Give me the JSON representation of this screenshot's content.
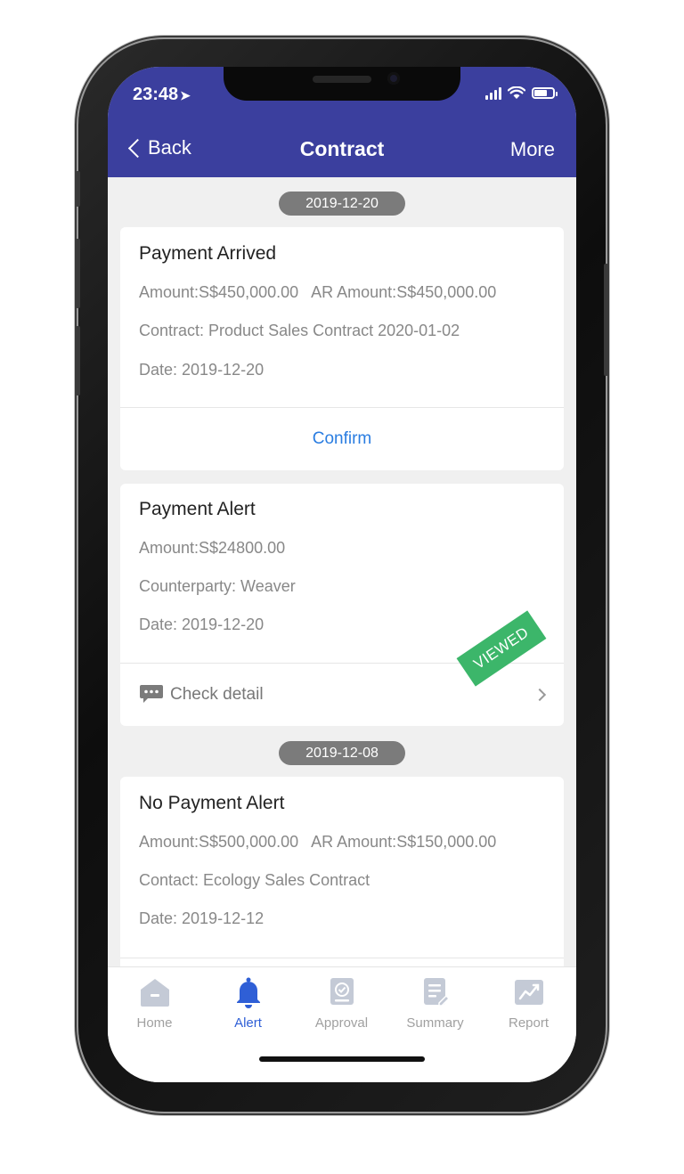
{
  "status_bar": {
    "time": "23:48"
  },
  "nav": {
    "back_label": "Back",
    "title": "Contract",
    "more_label": "More"
  },
  "groups": [
    {
      "date": "2019-12-20",
      "cards": [
        {
          "title": "Payment Arrived",
          "amount": "Amount:S$450,000.00",
          "ar_amount": "AR Amount:S$450,000.00",
          "line2": "Contract: Product Sales Contract 2020-01-02",
          "line3": "Date: 2019-12-20",
          "action": "Confirm"
        },
        {
          "title": "Payment Alert",
          "amount": "Amount:S$24800.00",
          "line2": "Counterparty: Weaver",
          "line3": "Date: 2019-12-20",
          "detail_label": "Check detail",
          "stamp": "VIEWED"
        }
      ]
    },
    {
      "date": "2019-12-08",
      "cards": [
        {
          "title": "No Payment Alert",
          "amount": "Amount:S$500,000.00",
          "ar_amount": "AR Amount:S$150,000.00",
          "line2": "Contact: Ecology Sales Contract",
          "line3": "Date: 2019-12-12"
        }
      ]
    }
  ],
  "tabs": [
    {
      "label": "Home",
      "icon": "home-icon",
      "active": false
    },
    {
      "label": "Alert",
      "icon": "bell-icon",
      "active": true
    },
    {
      "label": "Approval",
      "icon": "approval-icon",
      "active": false
    },
    {
      "label": "Summary",
      "icon": "summary-icon",
      "active": false
    },
    {
      "label": "Report",
      "icon": "report-icon",
      "active": false
    }
  ],
  "colors": {
    "header": "#3b3f9e",
    "link_blue": "#2a7de1",
    "active_tab": "#2f5fd6",
    "viewed_stamp": "#3cb66a"
  }
}
